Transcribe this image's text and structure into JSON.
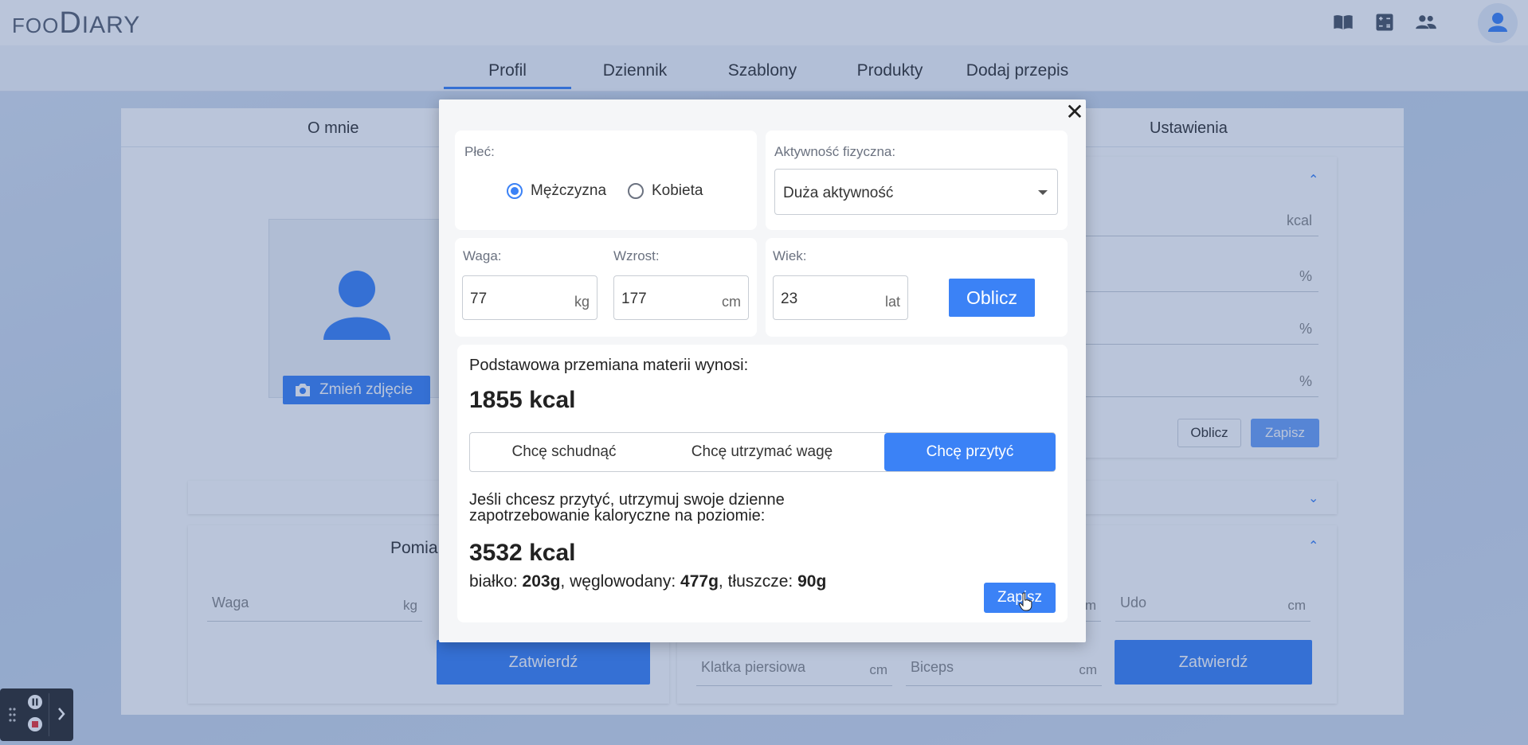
{
  "app": {
    "logo": {
      "part1": "FOO",
      "part2": "D",
      "part3": "IARY"
    }
  },
  "nav": {
    "tabs": [
      "Profil",
      "Dziennik",
      "Szablony",
      "Produkty",
      "Dodaj przepis"
    ],
    "active": "Profil"
  },
  "subtabs": {
    "about": "O mnie",
    "settings": "Ustawienia"
  },
  "profile": {
    "change_photo": "Zmień zdjęcie"
  },
  "right_card": {
    "units": [
      "kcal",
      "%",
      "%",
      "%"
    ],
    "calc_label": "Oblicz",
    "save_label": "Zapisz"
  },
  "measurements": {
    "title": "Pomia",
    "fields": [
      {
        "label": "Waga",
        "unit": "kg"
      },
      {
        "label": "",
        "unit": "m"
      },
      {
        "label": "Udo",
        "unit": "cm"
      },
      {
        "label": "Klatka piersiowa",
        "unit": "cm"
      },
      {
        "label": "Biceps",
        "unit": "cm"
      }
    ],
    "confirm_label": "Zatwierdź"
  },
  "modal": {
    "sex_label": "Płeć:",
    "sex_options": [
      "Mężczyzna",
      "Kobieta"
    ],
    "sex_selected": "Mężczyzna",
    "activity_label": "Aktywność fizyczna:",
    "activity_value": "Duża aktywność",
    "weight_label": "Waga:",
    "weight_value": "77",
    "weight_unit": "kg",
    "height_label": "Wzrost:",
    "height_value": "177",
    "height_unit": "cm",
    "age_label": "Wiek:",
    "age_value": "23",
    "age_unit": "lat",
    "calc_label": "Oblicz",
    "bmr_text": "Podstawowa przemiana materii wynosi:",
    "bmr_value": "1855 kcal",
    "goals": [
      "Chcę schudnąć",
      "Chcę utrzymać wagę",
      "Chcę przytyć"
    ],
    "goal_selected": "Chcę przytyć",
    "advice_line1": "Jeśli chcesz przytyć, utrzymuj swoje dzienne",
    "advice_line2": "zapotrzebowanie kaloryczne na poziomie:",
    "target_value": "3532 kcal",
    "protein_label": "białko:",
    "protein_value": "203g",
    "carbs_label": "węglowodany:",
    "carbs_value": "477g",
    "fat_label": "tłuszcze:",
    "fat_value": "90g",
    "save_label": "Zapisz"
  },
  "colors": {
    "accent": "#3b82f6"
  }
}
